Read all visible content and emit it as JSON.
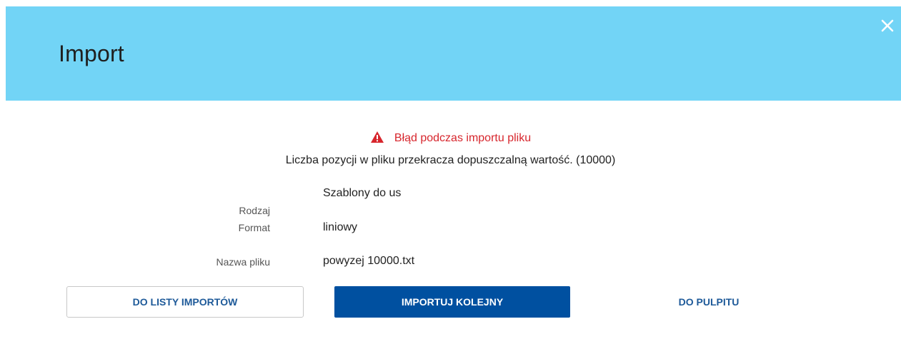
{
  "modal": {
    "title": "Import",
    "close_icon": "close-icon"
  },
  "error": {
    "icon": "warning-triangle-icon",
    "title": "Błąd podczas importu pliku",
    "message": "Liczba pozycji w pliku przekracza dopuszczalną wartość. (10000)",
    "color": "#d7262d"
  },
  "details": [
    {
      "label": "Rodzaj",
      "value": "Szablony do us"
    },
    {
      "label": "Format",
      "value": "liniowy"
    },
    {
      "label": "Nazwa pliku",
      "value": "powyzej 10000.txt"
    }
  ],
  "actions": {
    "to_import_list": "DO LISTY IMPORTÓW",
    "import_next": "IMPORTUJ KOLEJNY",
    "to_dashboard": "DO PULPITU"
  },
  "colors": {
    "header_bg": "#72d4f6",
    "primary": "#0050a0",
    "link": "#1e5a99"
  }
}
